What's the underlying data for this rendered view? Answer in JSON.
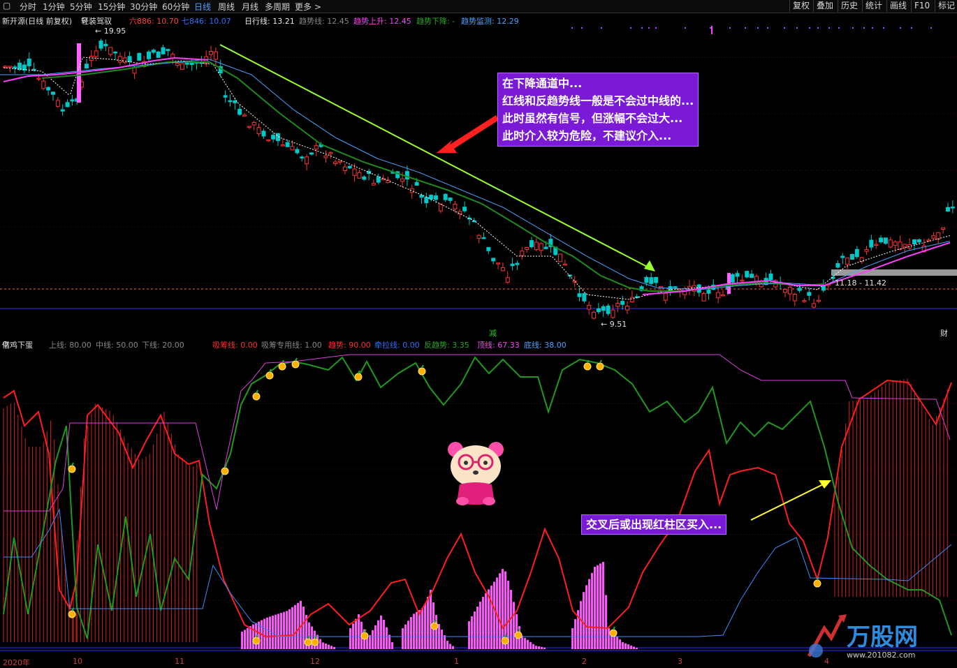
{
  "toolbar": {
    "tabs": [
      {
        "label": "分时",
        "active": false
      },
      {
        "label": "1分钟",
        "active": false
      },
      {
        "label": "5分钟",
        "active": false
      },
      {
        "label": "15分钟",
        "active": false
      },
      {
        "label": "30分钟",
        "active": false
      },
      {
        "label": "60分钟",
        "active": false
      },
      {
        "label": "日线",
        "active": true
      },
      {
        "label": "周线",
        "active": false
      },
      {
        "label": "月线",
        "active": false
      },
      {
        "label": "多周期",
        "active": false
      },
      {
        "label": "更多",
        "active": false
      }
    ],
    "right_buttons": [
      "复权",
      "叠加",
      "历史",
      "统计",
      "画线",
      "F10",
      "标记"
    ]
  },
  "main_info": {
    "stock": "新开源(日线 前复权)",
    "template": "轻装驾驭",
    "l6": "六886: 10.70",
    "l7": "七846: 10.07",
    "daily": "日行线: 13.21",
    "trend": "趋势线: 12.45",
    "trend_up": "趋势上升: 12.45",
    "trend_down": "趋势下降: -",
    "trend_mon": "趋势监测: 12.29"
  },
  "main_labels": {
    "high": "19.95",
    "low": "9.51",
    "range": "11.18 - 11.42",
    "jian": "减",
    "cai": "财"
  },
  "callout_main": [
    "在下降通道中...",
    "红线和反趋势线一般是不会过中线的...",
    "此时虽然有信号，但涨幅不会过大...",
    "此时介入较为危险，不建议介入..."
  ],
  "sub_info": {
    "name": "借鸡下蛋",
    "upper": "上线: 80.00",
    "mid": "中线: 50.00",
    "lower": "下线: 20.00",
    "xcx": "吸筹线: 0.00",
    "xczy": "吸筹专用线: 1.00",
    "qs": "趋势: 90.00",
    "qyx": "牵拉线: 0.00",
    "fqs": "反趋势: 3.35",
    "dx": "顶线: 67.33",
    "dix": "底线: 38.00"
  },
  "callout_sub": "交叉后或出现红柱区买入...",
  "date_axis": [
    "2020年",
    "10",
    "11",
    "12",
    "1",
    "2",
    "3",
    "4"
  ],
  "watermark": {
    "brand": "万股网",
    "site": "www.201082.com"
  },
  "colors": {
    "up": "#ff3232",
    "down": "#00c8c8",
    "ma_white": "#ffffff",
    "ma_magenta": "#ff40ff",
    "ma_green": "#1e8a1e",
    "ma_blue": "#4aa3ff",
    "arrow_green": "#99ff33",
    "callout_bg": "#7a19d6",
    "red_line": "#ff1e1e",
    "green_line": "#1f9a1f",
    "blue_line": "#3c8cff",
    "magenta_line": "#e040e0",
    "pink_bar": "#ff55ff"
  }
}
